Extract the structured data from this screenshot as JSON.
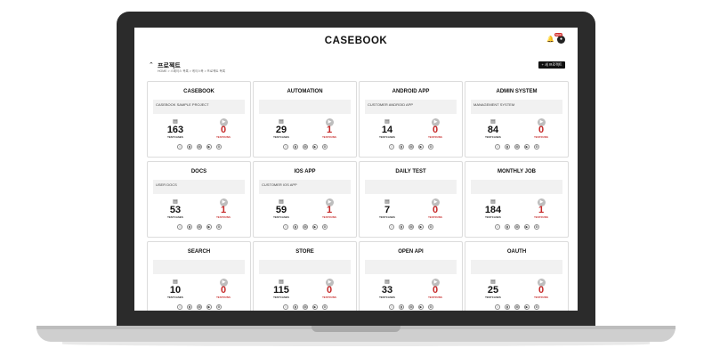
{
  "app": {
    "brand": "CASEBOOK",
    "badge": "NEW",
    "bell_icon": "bell-icon",
    "profile_icon": "profile-icon"
  },
  "page": {
    "title": "프로젝트",
    "breadcrumb": "HOME > 스페이스 목록 > 케이스북 > 프로젝트 목록",
    "new_button": "+ 새 프로젝트"
  },
  "labels": {
    "testcases": "TESTCASES",
    "testruns": "TESTRUNS"
  },
  "action_icons": [
    "info-icon",
    "chart-icon",
    "testcase-icon",
    "testrun-icon",
    "settings-icon"
  ],
  "projects": [
    {
      "name": "CASEBOOK",
      "description": "CASEBOOK SAMPLE PROJECT",
      "testcases": "163",
      "testruns": "0"
    },
    {
      "name": "AUTOMATION",
      "description": "",
      "testcases": "29",
      "testruns": "1"
    },
    {
      "name": "ANDROID APP",
      "description": "CUSTOMER ANDROID APP",
      "testcases": "14",
      "testruns": "0"
    },
    {
      "name": "ADMIN SYSTEM",
      "description": "MANAGEMENT SYSTEM",
      "testcases": "84",
      "testruns": "0"
    },
    {
      "name": "DOCS",
      "description": "USER DOCS",
      "testcases": "53",
      "testruns": "1"
    },
    {
      "name": "IOS APP",
      "description": "CUSTOMER IOS APP",
      "testcases": "59",
      "testruns": "1"
    },
    {
      "name": "DAILY TEST",
      "description": "",
      "testcases": "7",
      "testruns": "0"
    },
    {
      "name": "MONTHLY JOB",
      "description": "",
      "testcases": "184",
      "testruns": "1"
    },
    {
      "name": "SEARCH",
      "description": "",
      "testcases": "10",
      "testruns": "0"
    },
    {
      "name": "STORE",
      "description": "",
      "testcases": "115",
      "testruns": "0"
    },
    {
      "name": "OPEN API",
      "description": "",
      "testcases": "33",
      "testruns": "0"
    },
    {
      "name": "OAUTH",
      "description": "",
      "testcases": "25",
      "testruns": "0"
    }
  ]
}
